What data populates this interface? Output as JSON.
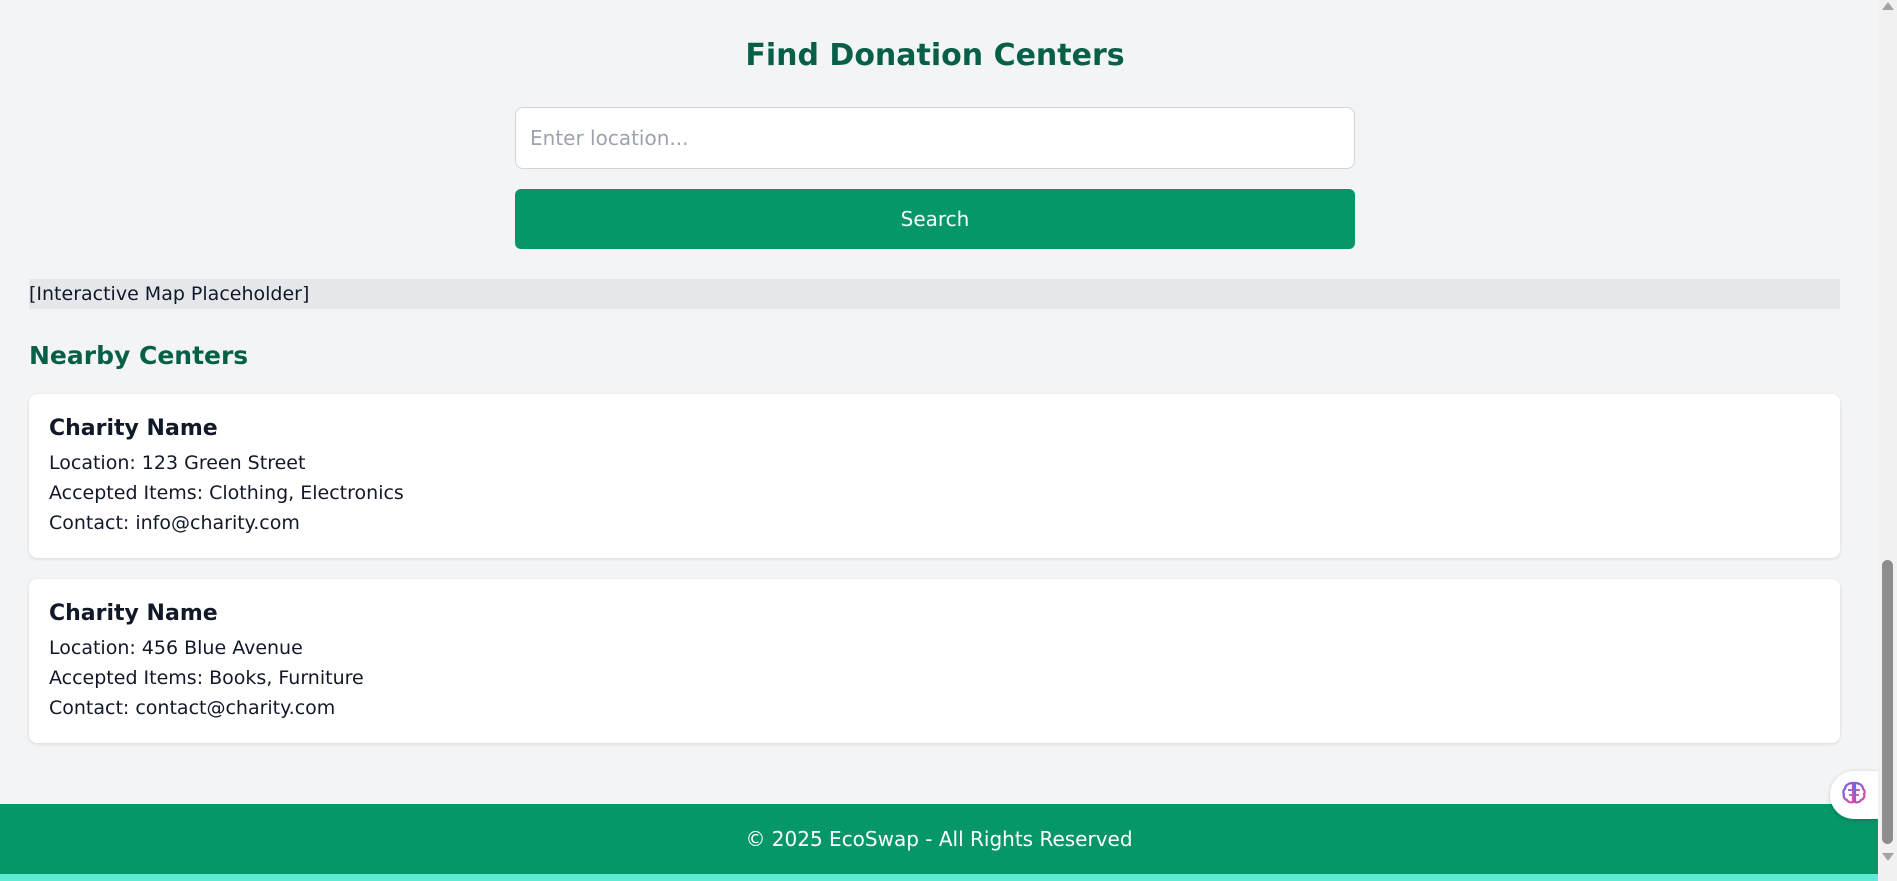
{
  "header": {
    "title": "Find Donation Centers"
  },
  "search": {
    "placeholder": "Enter location...",
    "value": "",
    "button_label": "Search"
  },
  "map": {
    "placeholder_text": "[Interactive Map Placeholder]"
  },
  "nearby": {
    "title": "Nearby Centers",
    "centers": [
      {
        "name": "Charity Name",
        "location": "Location: 123 Green Street",
        "accepted": "Accepted Items: Clothing, Electronics",
        "contact": "Contact: info@charity.com"
      },
      {
        "name": "Charity Name",
        "location": "Location: 456 Blue Avenue",
        "accepted": "Accepted Items: Books, Furniture",
        "contact": "Contact: contact@charity.com"
      }
    ]
  },
  "footer": {
    "text": "© 2025 EcoSwap - All Rights Reserved"
  },
  "floating_assistant": {
    "icon": "brain-icon"
  },
  "colors": {
    "primary": "#059669",
    "heading": "#065f46",
    "background": "#f3f4f6",
    "accent_strip": "#5eead4"
  }
}
